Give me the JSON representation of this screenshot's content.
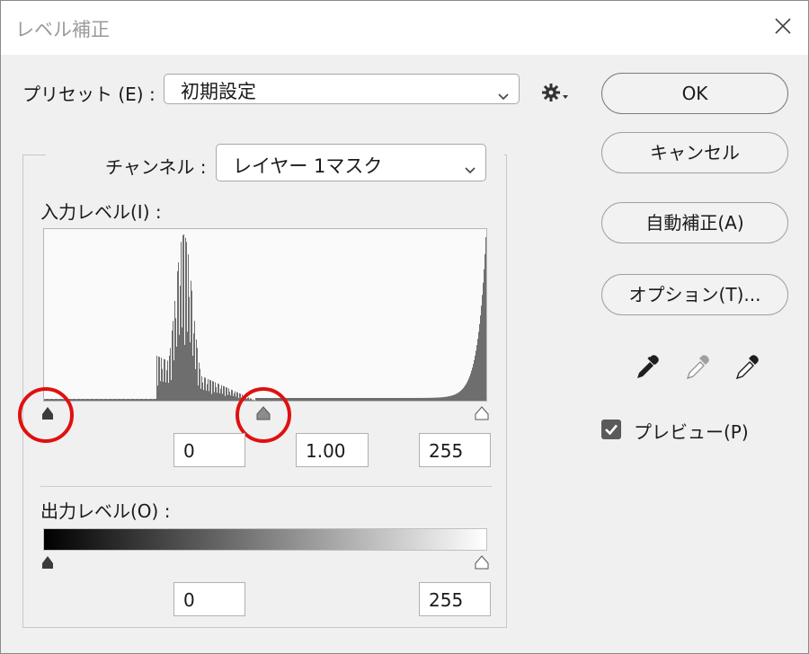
{
  "window": {
    "title": "レベル補正"
  },
  "preset": {
    "label": "プリセット (E) :",
    "value": "初期設定"
  },
  "channel": {
    "label": "チャンネル :",
    "value": "レイヤー 1マスク"
  },
  "input_levels": {
    "label": "入力レベル(I) :",
    "black": "0",
    "gamma": "1.00",
    "white": "255"
  },
  "output_levels": {
    "label": "出力レベル(O) :",
    "black": "0",
    "white": "255"
  },
  "buttons": {
    "ok": "OK",
    "cancel": "キャンセル",
    "auto": "自動補正(A)",
    "options": "オプション(T)..."
  },
  "preview": {
    "label": "プレビュー(P)",
    "checked": true
  },
  "icons": {
    "close": "close-icon",
    "gear": "gear-icon",
    "chevron": "chevron-down-icon",
    "eyedropper_black": "eyedropper-black-icon",
    "eyedropper_gray": "eyedropper-gray-icon",
    "eyedropper_white": "eyedropper-white-icon",
    "checkbox": "checkmark-icon"
  },
  "colors": {
    "highlight_ring": "#e01010",
    "histogram": "#6e6e6e"
  }
}
